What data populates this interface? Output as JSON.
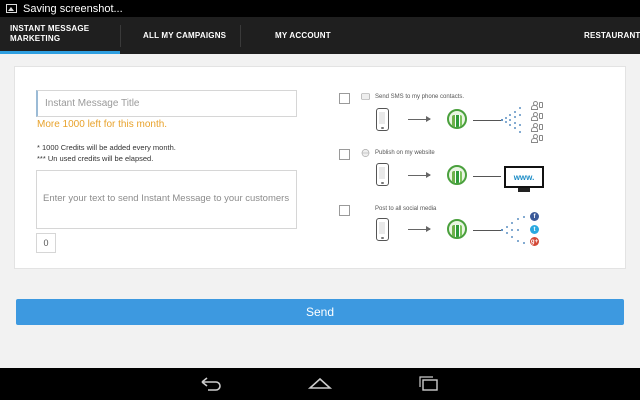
{
  "status_bar": {
    "text": "Saving screenshot..."
  },
  "nav": {
    "tabs": [
      {
        "label": "INSTANT MESSAGE MARKETING",
        "active": true
      },
      {
        "label": "ALL MY CAMPAIGNS",
        "active": false
      },
      {
        "label": "MY ACCOUNT",
        "active": false
      }
    ],
    "right_label": "RESTAURANT",
    "active_color": "#2f9fe0"
  },
  "form": {
    "title_placeholder": "Instant Message Title",
    "credits_left": "More 1000 left for this month.",
    "notes": [
      "* 1000 Credits will be added every month.",
      "*** Un used credits will be elapsed."
    ],
    "message_placeholder": "Enter your text to send Instant Message to your customers",
    "char_count": "0"
  },
  "options": [
    {
      "label": "Send SMS to my phone contacts.",
      "checked": false
    },
    {
      "label": "Publish on my website",
      "checked": false,
      "website_text": "www."
    },
    {
      "label": "Post to all social media",
      "checked": false,
      "social": [
        "f",
        "t",
        "g+"
      ]
    }
  ],
  "send_button": {
    "label": "Send",
    "color": "#3d99e0"
  },
  "accent_color": "#e8a22b"
}
